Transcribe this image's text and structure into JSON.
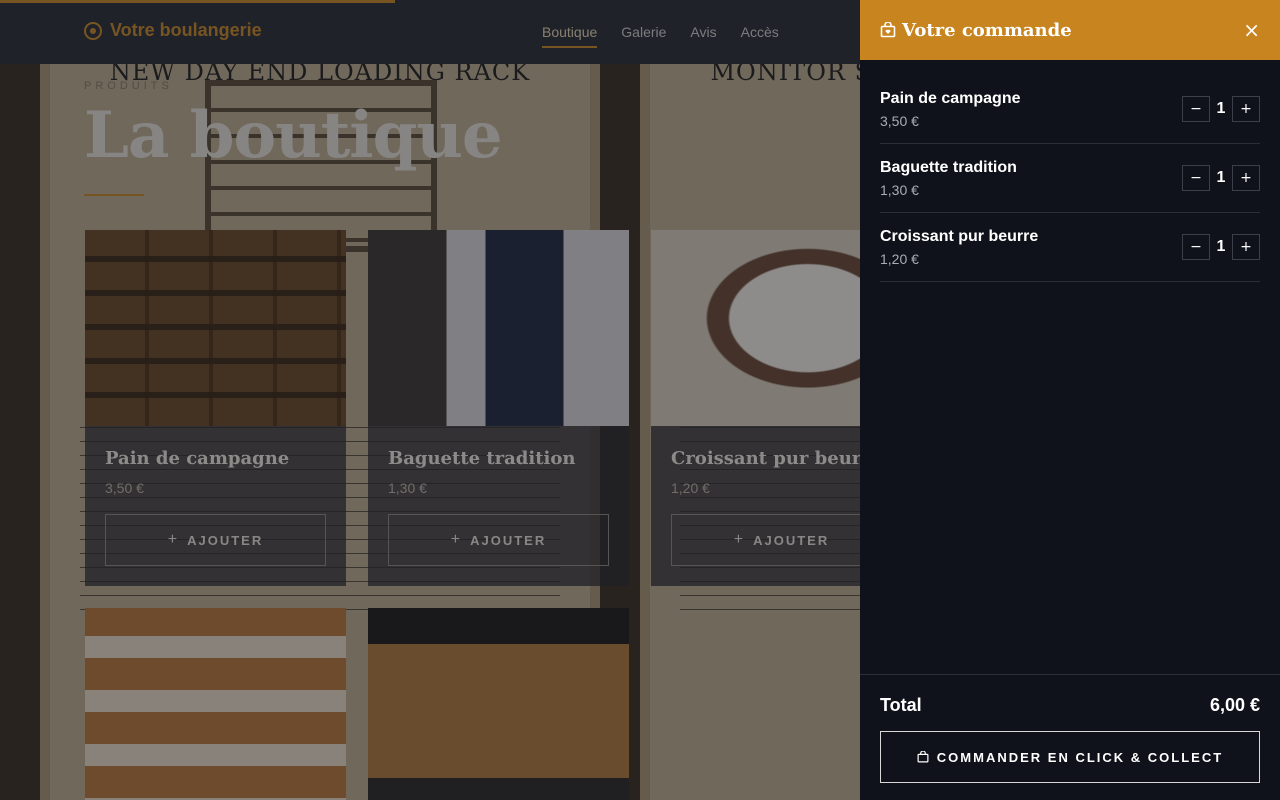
{
  "site": {
    "brand": "Votre boulangerie",
    "nav": [
      "Boutique",
      "Galerie",
      "Avis",
      "Accès"
    ],
    "active_nav": "Boutique",
    "section_label": "PRODUITS",
    "title": "La boutique",
    "background_text": {
      "left_heading": "NEW DAY END LOADING RACK",
      "right_heading": "MONITOR STYLE COAL TRUCK"
    },
    "add_label": "AJOUTER",
    "products": [
      {
        "name": "Pain de campagne",
        "price": "3,50 €"
      },
      {
        "name": "Baguette tradition",
        "price": "1,30 €"
      },
      {
        "name": "Croissant pur beurre",
        "price": "1,20 €"
      }
    ]
  },
  "cart": {
    "title": "Votre commande",
    "close": "×",
    "items": [
      {
        "name": "Pain de campagne",
        "price": "3,50 €",
        "qty": "1"
      },
      {
        "name": "Baguette tradition",
        "price": "1,30 €",
        "qty": "1"
      },
      {
        "name": "Croissant pur beurre",
        "price": "1,20 €",
        "qty": "1"
      }
    ],
    "minus": "−",
    "plus": "+",
    "total_label": "Total",
    "total_value": "6,00 €",
    "checkout_label": "COMMANDER EN CLICK & COLLECT"
  },
  "colors": {
    "accent": "#c7841f",
    "panel": "#0f121a"
  },
  "icons": {
    "brand": "bakery-logo-icon",
    "cart": "shopping-bag-icon",
    "close": "close-icon"
  }
}
